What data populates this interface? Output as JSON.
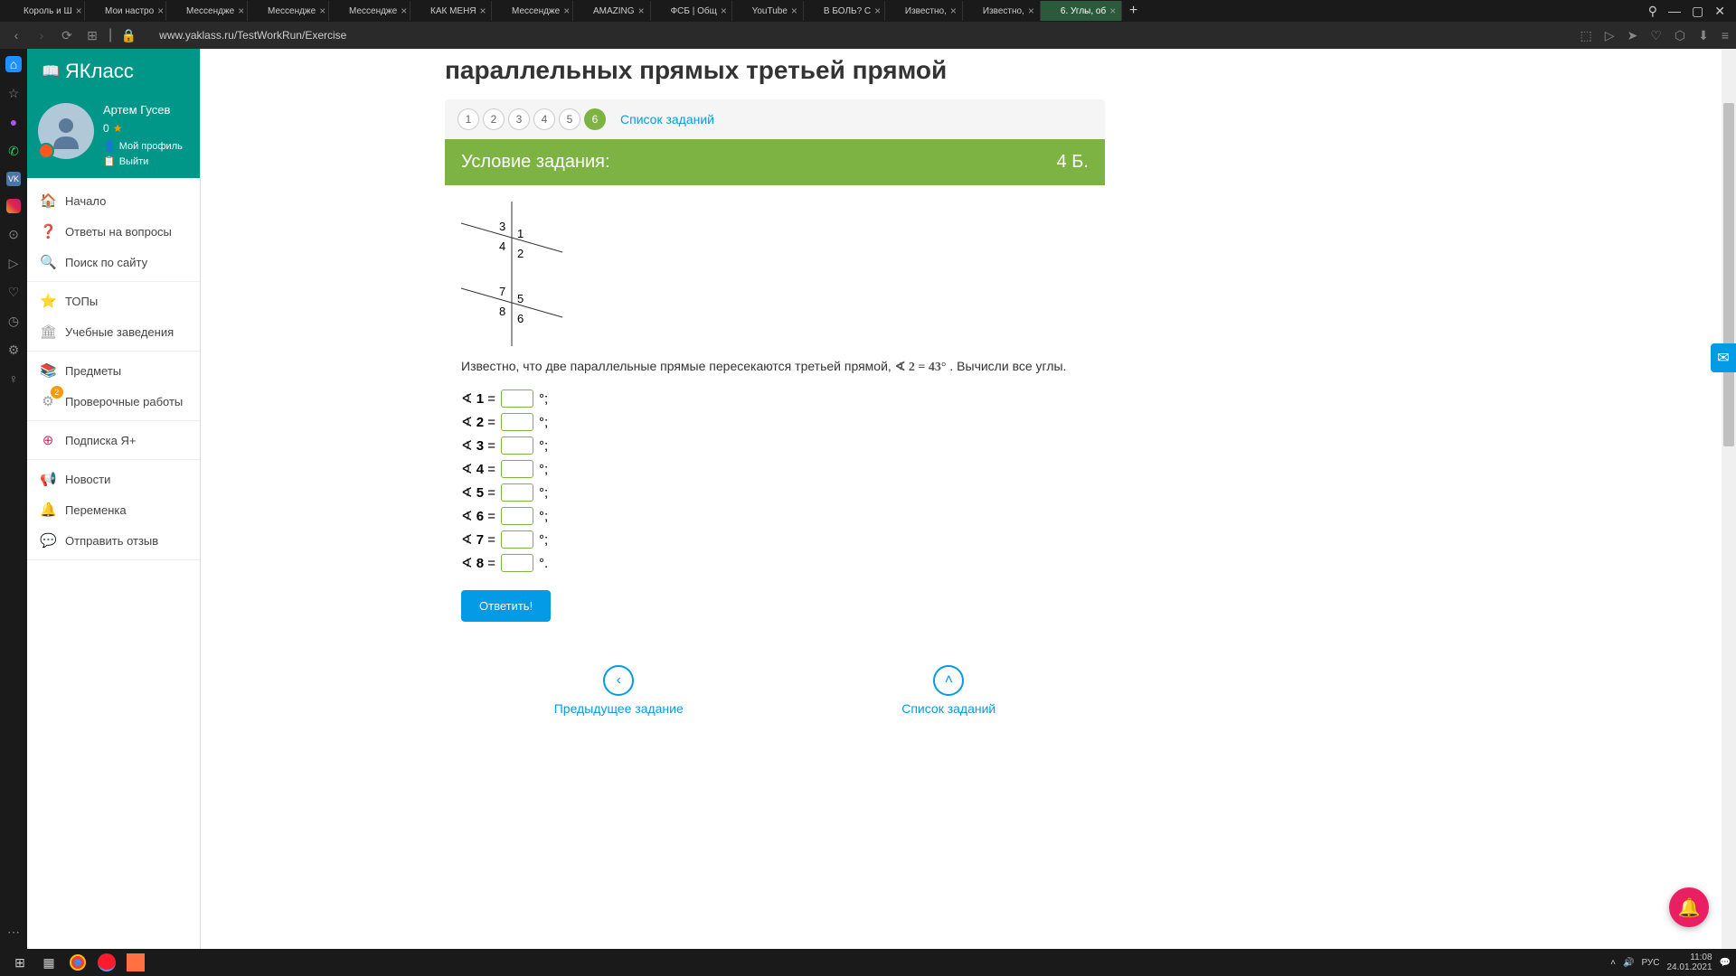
{
  "browser": {
    "tabs": [
      {
        "icon": "vk",
        "title": "Король и Ш"
      },
      {
        "icon": "vk",
        "title": "Мои настро"
      },
      {
        "icon": "msg",
        "title": "Мессендже"
      },
      {
        "icon": "msg",
        "title": "Мессендже"
      },
      {
        "icon": "msg",
        "title": "Мессендже"
      },
      {
        "icon": "yt",
        "title": "КАК МЕНЯ"
      },
      {
        "icon": "msg",
        "title": "Мессендже"
      },
      {
        "icon": "gs",
        "title": "AMAZING"
      },
      {
        "icon": "gd",
        "title": "ФСБ | Общ"
      },
      {
        "icon": "yt",
        "title": "YouTube"
      },
      {
        "icon": "yt",
        "title": "В БОЛЬ? С"
      },
      {
        "icon": "ya",
        "title": "Известно,"
      },
      {
        "icon": "z",
        "title": "Известно,"
      },
      {
        "icon": "yk",
        "title": "6. Углы, об",
        "active": true
      }
    ],
    "url": "www.yaklass.ru/TestWorkRun/Exercise"
  },
  "sidebar": {
    "logo": "ЯКласс",
    "user": {
      "name": "Артем Гусев",
      "points": "0",
      "profile": "Мой профиль",
      "logout": "Выйти"
    },
    "nav": [
      {
        "icon": "🏠",
        "label": "Начало",
        "color": "#ff9800"
      },
      {
        "icon": "❓",
        "label": "Ответы на вопросы",
        "color": "#039be5"
      },
      {
        "icon": "🔍",
        "label": "Поиск по сайту",
        "color": "#039be5"
      }
    ],
    "nav2": [
      {
        "icon": "⭐",
        "label": "ТОПы",
        "color": "#ffc107"
      },
      {
        "icon": "🏛",
        "label": "Учебные заведения",
        "color": "#9e9e9e"
      }
    ],
    "nav3": [
      {
        "icon": "📚",
        "label": "Предметы",
        "color": "#4caf50"
      },
      {
        "icon": "⚙",
        "label": "Проверочные работы",
        "color": "#9e9e9e",
        "badge": "2"
      }
    ],
    "nav4": [
      {
        "icon": "⊕",
        "label": "Подписка Я+",
        "color": "#e91e63"
      }
    ],
    "nav5": [
      {
        "icon": "📢",
        "label": "Новости",
        "color": "#607d8b"
      },
      {
        "icon": "🔔",
        "label": "Переменка",
        "color": "#424242"
      },
      {
        "icon": "💬",
        "label": "Отправить отзыв",
        "color": "#607d8b"
      }
    ]
  },
  "page": {
    "title": "параллельных прямых третьей прямой",
    "pager": {
      "items": [
        "1",
        "2",
        "3",
        "4",
        "5",
        "6"
      ],
      "active": 6,
      "link": "Список заданий"
    },
    "task_header": "Условие задания:",
    "task_points": "4 Б.",
    "diagram_labels": {
      "1": "1",
      "2": "2",
      "3": "3",
      "4": "4",
      "5": "5",
      "6": "6",
      "7": "7",
      "8": "8"
    },
    "task_text_1": "Известно, что две параллельные прямые пересекаются третьей прямой, ",
    "task_formula": "∢ 2 = 43°",
    "task_text_2": ". Вычисли все углы.",
    "angles": [
      {
        "n": "1",
        "end": "°;"
      },
      {
        "n": "2",
        "end": "°;"
      },
      {
        "n": "3",
        "end": "°;"
      },
      {
        "n": "4",
        "end": "°;"
      },
      {
        "n": "5",
        "end": "°;"
      },
      {
        "n": "6",
        "end": "°;"
      },
      {
        "n": "7",
        "end": "°;"
      },
      {
        "n": "8",
        "end": "°."
      }
    ],
    "answer_btn": "Ответить!",
    "prev": "Предыдущее задание",
    "list": "Список заданий"
  },
  "taskbar": {
    "lang": "РУС",
    "time": "11:08",
    "date": "24.01.2021"
  }
}
